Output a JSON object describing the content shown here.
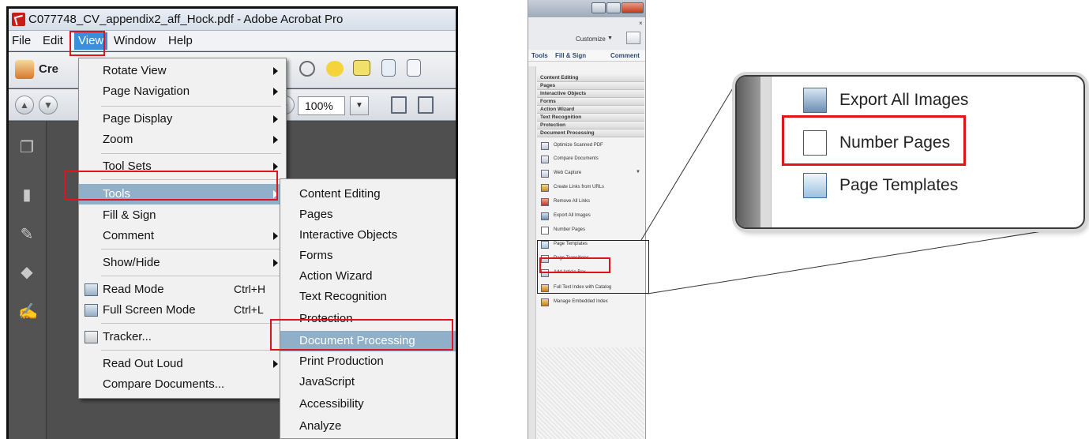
{
  "window": {
    "title": "C077748_CV_appendix2_aff_Hock.pdf - Adobe Acrobat Pro"
  },
  "menubar": [
    "File",
    "Edit",
    "View",
    "Window",
    "Help"
  ],
  "toolbar": {
    "create_label": "Cre",
    "zoom_value": "100%"
  },
  "view_menu": [
    {
      "label": "Rotate View",
      "arrow": true
    },
    {
      "label": "Page Navigation",
      "arrow": true
    },
    {
      "label": "Page Display",
      "arrow": true
    },
    {
      "label": "Zoom",
      "arrow": true
    },
    {
      "label": "Tool Sets",
      "arrow": true
    },
    {
      "label": "Tools",
      "arrow": true
    },
    {
      "label": "Fill & Sign"
    },
    {
      "label": "Comment",
      "arrow": true
    },
    {
      "label": "Show/Hide",
      "arrow": true
    },
    {
      "label": "Read Mode",
      "shortcut": "Ctrl+H"
    },
    {
      "label": "Full Screen Mode",
      "shortcut": "Ctrl+L"
    },
    {
      "label": "Tracker..."
    },
    {
      "label": "Read Out Loud",
      "arrow": true
    },
    {
      "label": "Compare Documents..."
    }
  ],
  "tools_menu": [
    "Content Editing",
    "Pages",
    "Interactive Objects",
    "Forms",
    "Action Wizard",
    "Text Recognition",
    "Protection",
    "Document Processing",
    "Print Production",
    "JavaScript",
    "Accessibility",
    "Analyze"
  ],
  "side_panel": {
    "customize_label": "Customize",
    "tabs": [
      "Tools",
      "Fill & Sign",
      "Comment"
    ],
    "sections": [
      "Content Editing",
      "Pages",
      "Interactive Objects",
      "Forms",
      "Action Wizard",
      "Text Recognition",
      "Protection",
      "Document Processing"
    ],
    "tools": [
      "Optimize Scanned PDF",
      "Compare Documents",
      "Web Capture",
      "Create Links from URLs",
      "Remove All Links",
      "Export All Images",
      "Number Pages",
      "Page Templates",
      "Page Transitions",
      "Add Article Box",
      "Full Text Index with Catalog",
      "Manage Embedded Index"
    ]
  },
  "callout": {
    "items": [
      "Export All Images",
      "Number Pages",
      "Page Templates"
    ]
  },
  "colors": {
    "highlight_red": "#e0151b",
    "menu_highlight": "#8fb0c8",
    "view_active": "#3a8ee0"
  }
}
